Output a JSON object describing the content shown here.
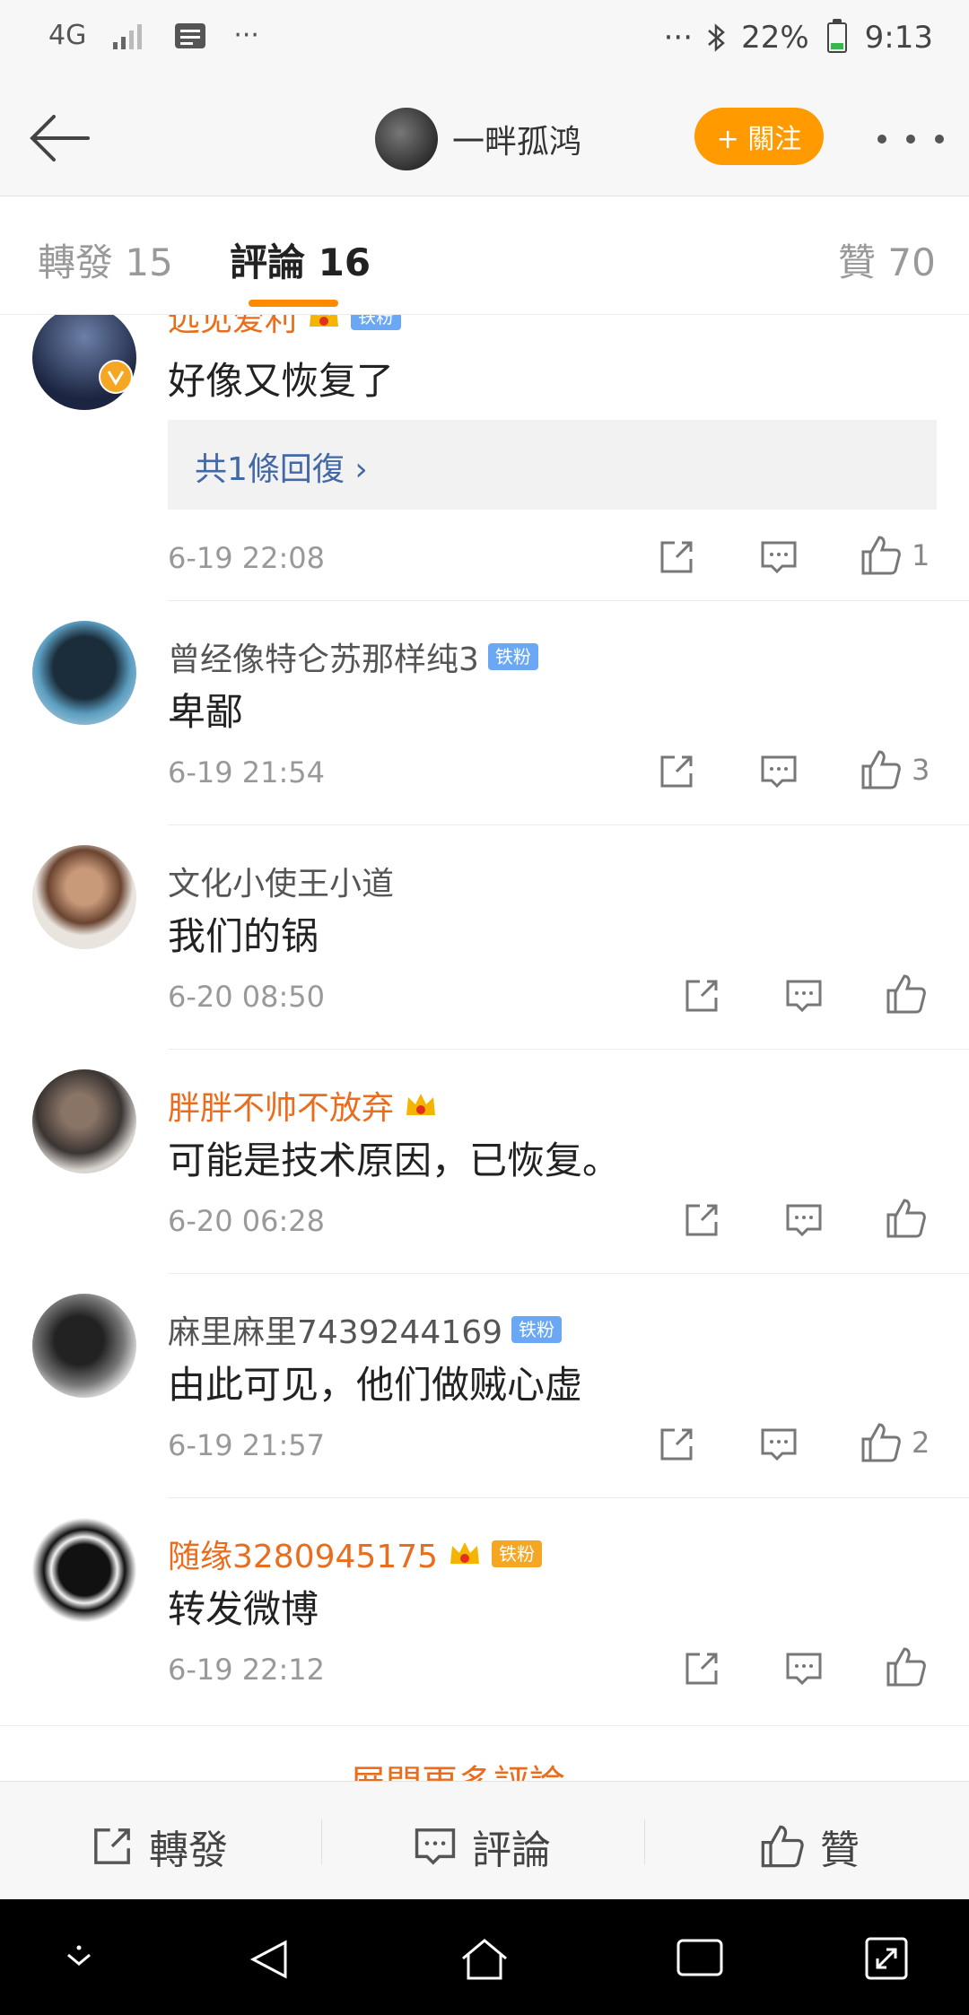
{
  "status_bar": {
    "network": "4G",
    "battery_percent": "22%",
    "time": "9:13",
    "dots": "···"
  },
  "nav": {
    "title": "一畔孤鸿",
    "follow_label": "+ 關注"
  },
  "tabs": {
    "forward": "轉發 15",
    "comments": "評論 16",
    "likes": "贊 70"
  },
  "comments": [
    {
      "name": "远见爱利",
      "name_color": "orange",
      "badge": "铁粉",
      "crown": true,
      "text": "好像又恢复了",
      "reply_text": "共1條回復 ›",
      "time": "6-19 22:08",
      "likes": "1"
    },
    {
      "name": "曾经像特仑苏那样纯3",
      "name_color": "gray",
      "badge": "铁粉",
      "crown": false,
      "text": "卑鄙",
      "time": "6-19 21:54",
      "likes": "3"
    },
    {
      "name": "文化小使王小道",
      "name_color": "gray",
      "badge": "",
      "crown": false,
      "text": "我们的锅",
      "time": "6-20 08:50",
      "likes": ""
    },
    {
      "name": "胖胖不帅不放弃",
      "name_color": "orange",
      "badge": "",
      "crown": true,
      "text": "可能是技术原因，已恢复。",
      "time": "6-20 06:28",
      "likes": ""
    },
    {
      "name": "麻里麻里7439244169",
      "name_color": "gray",
      "badge": "铁粉",
      "crown": false,
      "text": "由此可见，他们做贼心虚",
      "time": "6-19 21:57",
      "likes": "2"
    },
    {
      "name": "随缘3280945175",
      "name_color": "orange",
      "badge": "铁粉",
      "crown": true,
      "text": "转发微博",
      "time": "6-19 22:12",
      "likes": ""
    }
  ],
  "expand_label": "展開更多評論 ⌄",
  "bottom_bar": {
    "forward": "轉發",
    "comment": "評論",
    "like": "贊"
  },
  "colors": {
    "accent": "#ff9a00",
    "name_orange": "#e96d1d",
    "link_blue": "#4169a8",
    "badge_blue": "#6aa8f5"
  }
}
